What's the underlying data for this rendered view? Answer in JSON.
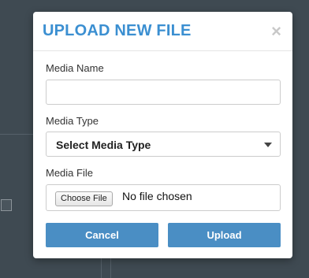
{
  "modal": {
    "title": "UPLOAD NEW FILE",
    "close_glyph": "×",
    "media_name": {
      "label": "Media Name",
      "value": "",
      "placeholder": ""
    },
    "media_type": {
      "label": "Media Type",
      "selected": "Select Media Type"
    },
    "media_file": {
      "label": "Media File",
      "choose_label": "Choose File",
      "status": "No file chosen"
    },
    "cancel_label": "Cancel",
    "upload_label": "Upload"
  },
  "colors": {
    "accent": "#3b8fd1",
    "button": "#4a8ec4",
    "backdrop": "#3f4a52"
  },
  "icons": {
    "close": "close-icon",
    "dropdown": "chevron-down-icon",
    "broken_image": "broken-image-icon"
  }
}
